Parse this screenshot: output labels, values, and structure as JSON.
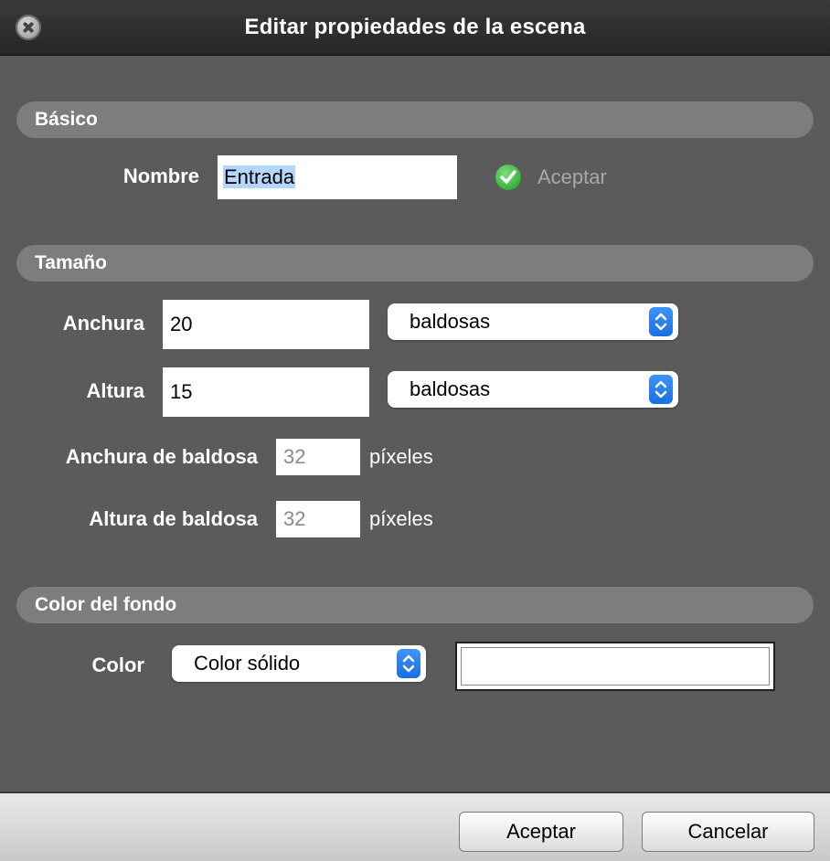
{
  "window": {
    "title": "Editar propiedades de la escena"
  },
  "sections": {
    "basico": "Básico",
    "tamano": "Tamaño",
    "color_fondo": "Color del fondo"
  },
  "basico": {
    "nombre_label": "Nombre",
    "nombre_value": "Entrada",
    "aceptar_label": "Aceptar"
  },
  "tamano": {
    "anchura_label": "Anchura",
    "anchura_value": "20",
    "anchura_unit": "baldosas",
    "altura_label": "Altura",
    "altura_value": "15",
    "altura_unit": "baldosas",
    "anchura_baldosa_label": "Anchura de baldosa",
    "anchura_baldosa_value": "32",
    "anchura_baldosa_unit": "píxeles",
    "altura_baldosa_label": "Altura de baldosa",
    "altura_baldosa_value": "32",
    "altura_baldosa_unit": "píxeles"
  },
  "color": {
    "color_label": "Color",
    "color_type": "Color sólido",
    "swatch_color": "#ffffff"
  },
  "footer": {
    "accept_label": "Aceptar",
    "cancel_label": "Cancelar"
  },
  "colors": {
    "background": "#5b5b5b",
    "section_header": "#7d7d7d",
    "accent_blue": "#1a6fe0",
    "check_green": "#1e9b1e"
  }
}
